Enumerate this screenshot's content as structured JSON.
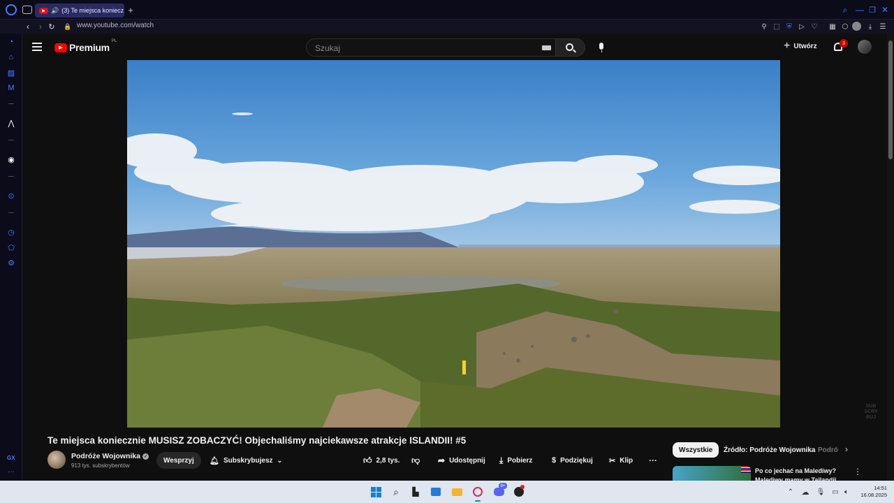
{
  "browser": {
    "tab_title": "(3) Te miejsca koniecznie MUSISZ ZOBACZYĆ! Objechaliśmy najciekawsze atrakcje ISLANDII! #5",
    "tab_title_short": "(3) Te miejsca koniecz",
    "url": "www.youtube.com/watch",
    "sidebar_gx_label": "GX"
  },
  "youtube": {
    "logo_text": "Premium",
    "logo_region": "PL",
    "search_placeholder": "Szukaj",
    "create_label": "Utwórz",
    "notification_count": "3",
    "watermark": "SUB SCRY BUJ",
    "video_title": "Te miejsca koniecznie MUSISZ ZOBACZYĆ! Objechaliśmy najciekawsze atrakcje ISLANDII! #5",
    "channel_name": "Podróże Wojownika",
    "subscriber_count": "913 tys. subskrybentów",
    "support_label": "Wesprzyj",
    "subscribed_label": "Subskrybujesz",
    "likes": "2,8 tys.",
    "share_label": "Udostępnij",
    "download_label": "Pobierz",
    "thanks_label": "Podziękuj",
    "clip_label": "Klip",
    "chips": [
      "Wszystkie",
      "Źródło: Podróże Wojownika",
      "Podró"
    ],
    "rec_title_line1": "Po co jechać na Malediwy?",
    "rec_title_line2": "Malediwy mamy w Tajlandii"
  },
  "taskbar": {
    "time": "14:51",
    "date": "16.08.2025",
    "discord_badge": "9+"
  },
  "colors": {
    "brand_red": "#ff0000",
    "opera_accent": "#4f7dff",
    "tab_active": "#2a2a62"
  }
}
